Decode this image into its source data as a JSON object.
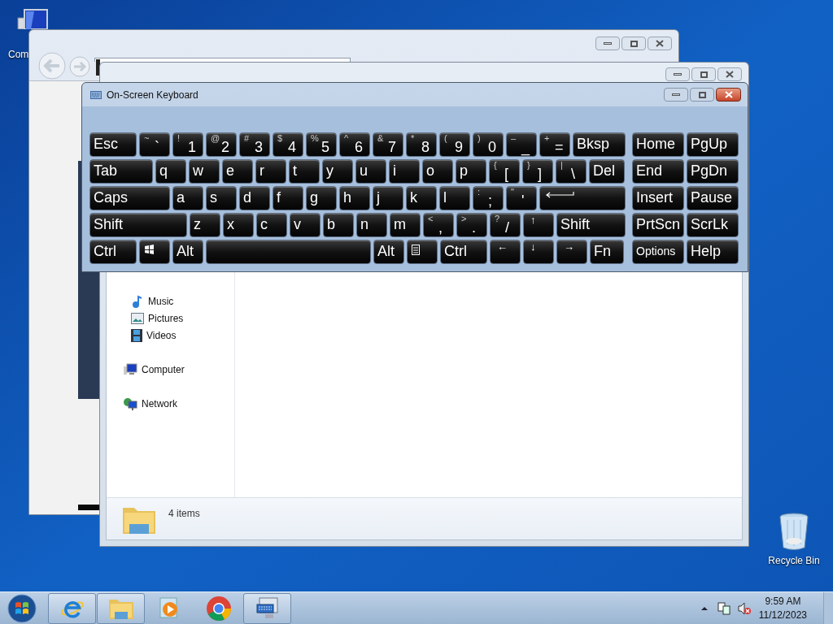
{
  "desktop_icons": [
    {
      "label": "Com",
      "kind": "computer"
    },
    {
      "label": "Recycle Bin",
      "kind": "recycle-bin"
    }
  ],
  "explorer": {
    "nav_tree": [
      {
        "children": [
          {
            "label": "Music",
            "kind": "music"
          },
          {
            "label": "Pictures",
            "kind": "pictures"
          },
          {
            "label": "Videos",
            "kind": "videos"
          }
        ]
      },
      {
        "label": "Computer",
        "kind": "computer"
      },
      {
        "label": "Network",
        "kind": "network"
      }
    ],
    "status_text": "4 items"
  },
  "keyboard": {
    "title": "On-Screen Keyboard",
    "rows": [
      {
        "keys": [
          {
            "label": "Esc"
          },
          {
            "shift": "~",
            "label": "`"
          },
          {
            "shift": "!",
            "label": "1"
          },
          {
            "shift": "@",
            "label": "2"
          },
          {
            "shift": "#",
            "label": "3"
          },
          {
            "shift": "$",
            "label": "4"
          },
          {
            "shift": "%",
            "label": "5"
          },
          {
            "shift": "^",
            "label": "6"
          },
          {
            "shift": "&",
            "label": "7"
          },
          {
            "shift": "*",
            "label": "8"
          },
          {
            "shift": "(",
            "label": "9"
          },
          {
            "shift": ")",
            "label": "0"
          },
          {
            "shift": "–",
            "label": "_"
          },
          {
            "shift": "+",
            "label": "="
          },
          {
            "label": "Bksp"
          }
        ]
      },
      {
        "keys": [
          {
            "label": "Tab"
          },
          {
            "label": "q"
          },
          {
            "label": "w"
          },
          {
            "label": "e"
          },
          {
            "label": "r"
          },
          {
            "label": "t"
          },
          {
            "label": "y"
          },
          {
            "label": "u"
          },
          {
            "label": "i"
          },
          {
            "label": "o"
          },
          {
            "label": "p"
          },
          {
            "shift": "{",
            "label": "["
          },
          {
            "shift": "}",
            "label": "]"
          },
          {
            "shift": "|",
            "label": "\\"
          },
          {
            "label": "Del"
          }
        ]
      },
      {
        "keys": [
          {
            "label": "Caps"
          },
          {
            "label": "a"
          },
          {
            "label": "s"
          },
          {
            "label": "d"
          },
          {
            "label": "f"
          },
          {
            "label": "g"
          },
          {
            "label": "h"
          },
          {
            "label": "j"
          },
          {
            "label": "k"
          },
          {
            "label": "l"
          },
          {
            "shift": ":",
            "label": ";"
          },
          {
            "shift": "\"",
            "label": "'"
          },
          {
            "kind": "enter"
          }
        ]
      },
      {
        "keys": [
          {
            "label": "Shift"
          },
          {
            "label": "z"
          },
          {
            "label": "x"
          },
          {
            "label": "c"
          },
          {
            "label": "v"
          },
          {
            "label": "b"
          },
          {
            "label": "n"
          },
          {
            "label": "m"
          },
          {
            "shift": "<",
            "label": ","
          },
          {
            "shift": ">",
            "label": "."
          },
          {
            "shift": "?",
            "label": "/"
          },
          {
            "label": "↑",
            "kind": "arrow"
          },
          {
            "label": "Shift"
          }
        ]
      },
      {
        "keys": [
          {
            "label": "Ctrl"
          },
          {
            "kind": "windows"
          },
          {
            "label": "Alt"
          },
          {
            "kind": "space"
          },
          {
            "label": "Alt"
          },
          {
            "kind": "menu"
          },
          {
            "label": "Ctrl"
          },
          {
            "label": "←",
            "kind": "arrow"
          },
          {
            "label": "↓",
            "kind": "arrow"
          },
          {
            "label": "→",
            "kind": "arrow"
          },
          {
            "label": "Fn"
          }
        ]
      }
    ],
    "side_rows": [
      {
        "keys": [
          {
            "label": "Home"
          },
          {
            "label": "PgUp"
          }
        ]
      },
      {
        "keys": [
          {
            "label": "End"
          },
          {
            "label": "PgDn"
          }
        ]
      },
      {
        "keys": [
          {
            "label": "Insert"
          },
          {
            "label": "Pause"
          }
        ]
      },
      {
        "keys": [
          {
            "label": "PrtScn"
          },
          {
            "label": "ScrLk"
          }
        ]
      },
      {
        "keys": [
          {
            "label": "Options",
            "kind": "small"
          },
          {
            "label": "Help"
          }
        ]
      }
    ]
  },
  "taskbar": {
    "apps": [
      {
        "kind": "ie",
        "running": true
      },
      {
        "kind": "explorer",
        "running": true
      },
      {
        "kind": "media",
        "running": false
      },
      {
        "kind": "chrome",
        "running": false
      },
      {
        "kind": "keyboard",
        "running": true
      }
    ],
    "time": "9:59 AM",
    "date": "11/12/2023"
  }
}
